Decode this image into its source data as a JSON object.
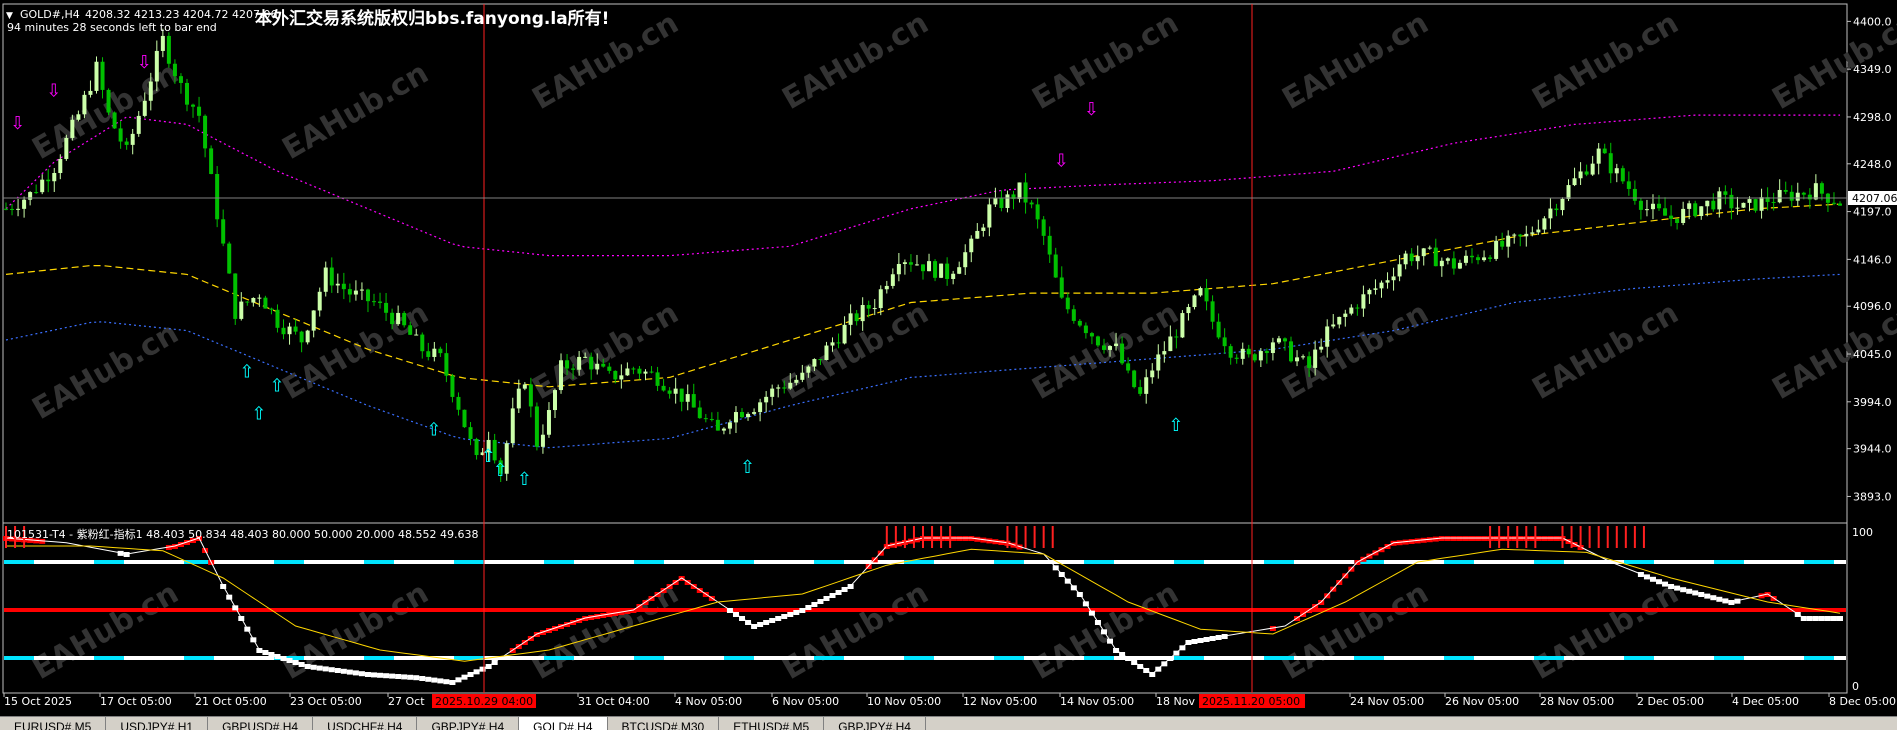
{
  "chart_header": {
    "symbol": "GOLD#,H4",
    "ohlc": "4208.32 4213.23 4204.72 4207.06",
    "timer": "94 minutes 28 seconds left to bar end"
  },
  "copyright": "本外汇交易系统版权归bbs.fanyong.la所有!",
  "watermark": "EAHub.cn",
  "indicator_header": "101531-T4 - 紫粉红-指标1 48.403 50.834 48.403 80.000 50.000 20.000 48.552 49.638",
  "price_axis": [
    "4400.0",
    "4349.0",
    "4298.0",
    "4248.0",
    "4197.0",
    "4146.0",
    "4096.0",
    "4045.0",
    "3994.0",
    "3944.0",
    "3893.0"
  ],
  "current_price": "4207.06",
  "indicator_axis": [
    "100",
    "0"
  ],
  "time_axis": [
    "15 Oct 2025",
    "17 Oct 05:00",
    "21 Oct 05:00",
    "23 Oct 05:00",
    "27 Oct",
    "31 Oct 04:00",
    "4 Nov 05:00",
    "6 Nov 05:00",
    "10 Nov 05:00",
    "12 Nov 05:00",
    "14 Nov 05:00",
    "18 Nov",
    "24 Nov 05:00",
    "26 Nov 05:00",
    "28 Nov 05:00",
    "2 Dec 05:00",
    "4 Dec 05:00",
    "8 Dec 05:00"
  ],
  "time_markers": [
    "2025.10.29 04:00",
    "2025.11.20 05:00"
  ],
  "tabs": [
    "EURUSD#,M5",
    "USDJPY#,H1",
    "GBPUSD#,H4",
    "USDCHF#,H4",
    "GBPJPY#,H4",
    "GOLD#,H4",
    "BTCUSD#,M30",
    "ETHUSD#,M5",
    "GBPJPY#,H4"
  ],
  "active_tab": "GOLD#,H4",
  "colors": {
    "background": "#000000",
    "bull_candle": "#ccffaa",
    "bear_candle": "#00c000",
    "upper_band": "#ff00ff",
    "middle_band": "#ffd700",
    "lower_band": "#3a6fff",
    "marker_line": "#ff2020",
    "arrow_down": "#ff00ff",
    "arrow_up": "#00ffff"
  },
  "chart_data": {
    "type": "candlestick",
    "symbol": "GOLD#",
    "timeframe": "H4",
    "ylim": [
      3870,
      4410
    ],
    "close_path": [
      [
        0,
        4200
      ],
      [
        4,
        4215
      ],
      [
        8,
        4245
      ],
      [
        12,
        4300
      ],
      [
        15,
        4350
      ],
      [
        17,
        4300
      ],
      [
        20,
        4260
      ],
      [
        23,
        4320
      ],
      [
        26,
        4380
      ],
      [
        29,
        4330
      ],
      [
        32,
        4300
      ],
      [
        34,
        4230
      ],
      [
        36,
        4160
      ],
      [
        38,
        4090
      ],
      [
        42,
        4110
      ],
      [
        45,
        4080
      ],
      [
        49,
        4060
      ],
      [
        53,
        4130
      ],
      [
        57,
        4110
      ],
      [
        61,
        4100
      ],
      [
        65,
        4080
      ],
      [
        69,
        4050
      ],
      [
        72,
        4040
      ],
      [
        75,
        3990
      ],
      [
        78,
        3930
      ],
      [
        80,
        3960
      ],
      [
        82,
        3920
      ],
      [
        84,
        3980
      ],
      [
        86,
        4020
      ],
      [
        88,
        3950
      ],
      [
        90,
        3980
      ],
      [
        92,
        4030
      ],
      [
        96,
        4040
      ],
      [
        100,
        4020
      ],
      [
        104,
        4030
      ],
      [
        108,
        4020
      ],
      [
        112,
        4000
      ],
      [
        115,
        3980
      ],
      [
        118,
        3960
      ],
      [
        120,
        3980
      ],
      [
        124,
        3990
      ],
      [
        128,
        4010
      ],
      [
        132,
        4020
      ],
      [
        136,
        4050
      ],
      [
        140,
        4080
      ],
      [
        144,
        4100
      ],
      [
        148,
        4150
      ],
      [
        152,
        4140
      ],
      [
        156,
        4130
      ],
      [
        160,
        4160
      ],
      [
        163,
        4200
      ],
      [
        166,
        4210
      ],
      [
        168,
        4220
      ],
      [
        170,
        4200
      ],
      [
        172,
        4170
      ],
      [
        175,
        4100
      ],
      [
        178,
        4080
      ],
      [
        181,
        4060
      ],
      [
        184,
        4050
      ],
      [
        186,
        4020
      ],
      [
        188,
        4000
      ],
      [
        190,
        4030
      ],
      [
        193,
        4060
      ],
      [
        196,
        4090
      ],
      [
        198,
        4110
      ],
      [
        200,
        4080
      ],
      [
        203,
        4050
      ],
      [
        206,
        4040
      ],
      [
        210,
        4060
      ],
      [
        214,
        4040
      ],
      [
        216,
        4030
      ],
      [
        218,
        4060
      ],
      [
        221,
        4080
      ],
      [
        224,
        4100
      ],
      [
        228,
        4120
      ],
      [
        232,
        4150
      ],
      [
        236,
        4150
      ],
      [
        240,
        4140
      ],
      [
        244,
        4150
      ],
      [
        248,
        4160
      ],
      [
        252,
        4170
      ],
      [
        256,
        4200
      ],
      [
        260,
        4230
      ],
      [
        264,
        4260
      ],
      [
        268,
        4230
      ],
      [
        272,
        4200
      ],
      [
        276,
        4190
      ],
      [
        280,
        4200
      ],
      [
        284,
        4210
      ],
      [
        288,
        4200
      ],
      [
        292,
        4210
      ],
      [
        296,
        4215
      ],
      [
        300,
        4220
      ],
      [
        304,
        4207
      ]
    ],
    "bands": {
      "upper": [
        [
          0,
          4200
        ],
        [
          8,
          4250
        ],
        [
          20,
          4298
        ],
        [
          30,
          4290
        ],
        [
          45,
          4240
        ],
        [
          60,
          4200
        ],
        [
          75,
          4160
        ],
        [
          90,
          4150
        ],
        [
          110,
          4150
        ],
        [
          130,
          4160
        ],
        [
          150,
          4200
        ],
        [
          165,
          4220
        ],
        [
          180,
          4225
        ],
        [
          200,
          4230
        ],
        [
          220,
          4240
        ],
        [
          240,
          4270
        ],
        [
          260,
          4290
        ],
        [
          280,
          4300
        ],
        [
          304,
          4300
        ]
      ],
      "middle": [
        [
          0,
          4130
        ],
        [
          15,
          4140
        ],
        [
          30,
          4130
        ],
        [
          45,
          4090
        ],
        [
          60,
          4050
        ],
        [
          75,
          4020
        ],
        [
          90,
          4010
        ],
        [
          110,
          4020
        ],
        [
          130,
          4060
        ],
        [
          150,
          4100
        ],
        [
          170,
          4110
        ],
        [
          190,
          4110
        ],
        [
          210,
          4120
        ],
        [
          230,
          4145
        ],
        [
          250,
          4170
        ],
        [
          270,
          4185
        ],
        [
          290,
          4200
        ],
        [
          304,
          4205
        ]
      ],
      "lower": [
        [
          0,
          4060
        ],
        [
          15,
          4080
        ],
        [
          30,
          4070
        ],
        [
          45,
          4030
        ],
        [
          60,
          3990
        ],
        [
          75,
          3955
        ],
        [
          90,
          3945
        ],
        [
          110,
          3955
        ],
        [
          130,
          3990
        ],
        [
          150,
          4020
        ],
        [
          170,
          4030
        ],
        [
          190,
          4040
        ],
        [
          210,
          4050
        ],
        [
          230,
          4070
        ],
        [
          250,
          4100
        ],
        [
          270,
          4115
        ],
        [
          290,
          4125
        ],
        [
          304,
          4130
        ]
      ]
    },
    "indicator": {
      "levels": [
        80,
        50,
        20
      ],
      "ylim": [
        0,
        100
      ],
      "white_line": [
        [
          0,
          95
        ],
        [
          10,
          92
        ],
        [
          20,
          85
        ],
        [
          28,
          90
        ],
        [
          32,
          95
        ],
        [
          36,
          65
        ],
        [
          42,
          25
        ],
        [
          50,
          15
        ],
        [
          60,
          10
        ],
        [
          68,
          8
        ],
        [
          74,
          5
        ],
        [
          80,
          15
        ],
        [
          88,
          35
        ],
        [
          96,
          45
        ],
        [
          104,
          50
        ],
        [
          112,
          70
        ],
        [
          118,
          55
        ],
        [
          124,
          40
        ],
        [
          132,
          50
        ],
        [
          140,
          65
        ],
        [
          146,
          90
        ],
        [
          152,
          95
        ],
        [
          160,
          95
        ],
        [
          166,
          92
        ],
        [
          172,
          85
        ],
        [
          178,
          60
        ],
        [
          184,
          25
        ],
        [
          190,
          10
        ],
        [
          196,
          30
        ],
        [
          204,
          35
        ],
        [
          212,
          40
        ],
        [
          218,
          55
        ],
        [
          224,
          80
        ],
        [
          230,
          92
        ],
        [
          238,
          95
        ],
        [
          248,
          95
        ],
        [
          258,
          95
        ],
        [
          266,
          80
        ],
        [
          276,
          65
        ],
        [
          286,
          55
        ],
        [
          292,
          60
        ],
        [
          298,
          45
        ],
        [
          304,
          45
        ]
      ],
      "yellow_line": [
        [
          0,
          90
        ],
        [
          14,
          90
        ],
        [
          26,
          87
        ],
        [
          36,
          70
        ],
        [
          48,
          40
        ],
        [
          62,
          25
        ],
        [
          76,
          18
        ],
        [
          90,
          25
        ],
        [
          104,
          40
        ],
        [
          118,
          55
        ],
        [
          132,
          60
        ],
        [
          146,
          78
        ],
        [
          160,
          88
        ],
        [
          172,
          85
        ],
        [
          186,
          55
        ],
        [
          198,
          38
        ],
        [
          210,
          35
        ],
        [
          222,
          55
        ],
        [
          234,
          80
        ],
        [
          248,
          88
        ],
        [
          262,
          86
        ],
        [
          276,
          70
        ],
        [
          292,
          55
        ],
        [
          304,
          48
        ]
      ]
    }
  }
}
